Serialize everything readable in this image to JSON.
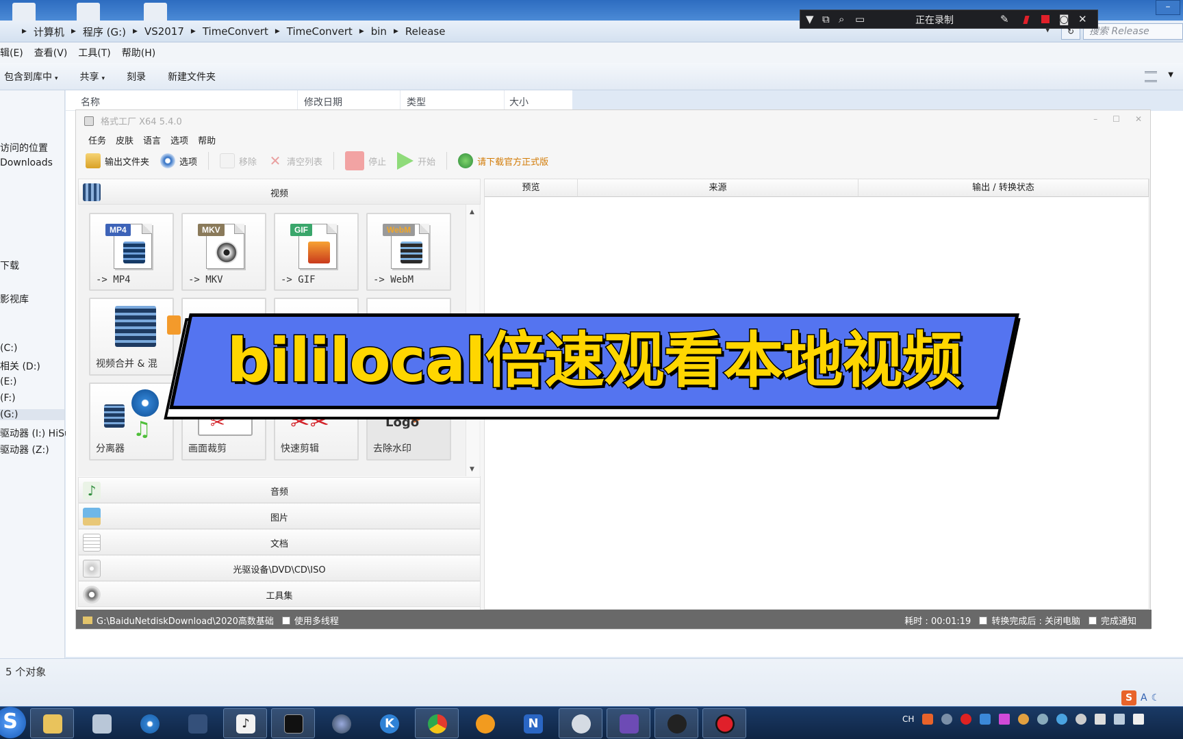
{
  "explorer": {
    "breadcrumbs": [
      "计算机",
      "程序 (G:)",
      "VS2017",
      "TimeConvert",
      "TimeConvert",
      "bin",
      "Release"
    ],
    "search_placeholder": "搜索 Release",
    "menu": [
      "辑(E)",
      "查看(V)",
      "工具(T)",
      "帮助(H)"
    ],
    "toolbar": [
      {
        "label": "包含到库中",
        "caret": "▾"
      },
      {
        "label": "共享",
        "caret": "▾"
      },
      {
        "label": "刻录",
        "caret": ""
      },
      {
        "label": "新建文件夹",
        "caret": ""
      }
    ],
    "columns": [
      "名称",
      "修改日期",
      "类型",
      "大小"
    ],
    "nav_items": [
      "访问的位置",
      "Downloads",
      "下载",
      "影视库",
      "(C:)",
      "相关 (D:)",
      "(E:)",
      "(F:)",
      "(G:)",
      "驱动器 (I:) HiSu",
      "驱动器 (Z:)"
    ],
    "status_count": "5 个对象"
  },
  "recorder": {
    "status": "正在录制"
  },
  "ff": {
    "title": "格式工厂 X64 5.4.0",
    "menu": [
      "任务",
      "皮肤",
      "语言",
      "选项",
      "帮助"
    ],
    "tools": {
      "output_folder": "输出文件夹",
      "options": "选项",
      "remove": "移除",
      "clear_list": "清空列表",
      "stop": "停止",
      "start": "开始",
      "download_link": "请下载官方正式版"
    },
    "categories": {
      "video": "视频",
      "audio": "音频",
      "image": "图片",
      "document": "文档",
      "disc": "光驱设备\\DVD\\CD\\ISO",
      "toolset": "工具集"
    },
    "tiles": [
      {
        "label": "-> MP4",
        "badge": "MP4"
      },
      {
        "label": "-> MKV",
        "badge": "MKV"
      },
      {
        "label": "-> GIF",
        "badge": "GIF"
      },
      {
        "label": "-> WebM",
        "badge": "WebM"
      },
      {
        "label": "视频合并 & 混"
      },
      {
        "label": "分离器"
      },
      {
        "label": "画面裁剪"
      },
      {
        "label": "快速剪辑"
      },
      {
        "label": "去除水印",
        "logo_text": "Logo"
      }
    ],
    "right_headers": [
      "预览",
      "来源",
      "输出 / 转换状态"
    ],
    "status": {
      "path": "G:\\BaiduNetdiskDownload\\2020高数基础",
      "multithread": "使用多线程",
      "elapsed": "耗时 : 00:01:19",
      "after_convert": "转换完成后 : 关闭电脑",
      "notify": "完成通知"
    }
  },
  "banner": {
    "text": "bililocal倍速观看本地视频"
  },
  "ime": {
    "s": "S",
    "a": "A"
  },
  "taskbar": {
    "start": "S",
    "k_app": "K",
    "n_app": "N",
    "tray_lang": "CH"
  }
}
